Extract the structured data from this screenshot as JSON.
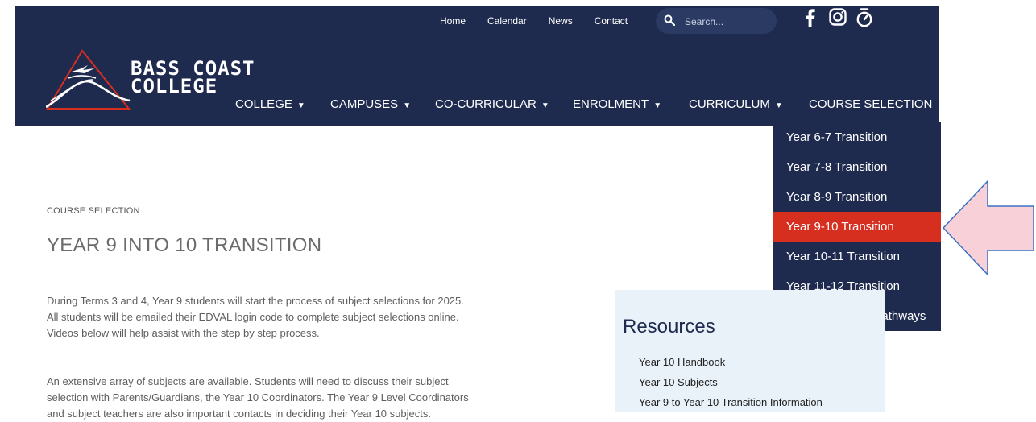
{
  "top_nav": [
    "Home",
    "Calendar",
    "News",
    "Contact"
  ],
  "search": {
    "placeholder": "Search..."
  },
  "brand": {
    "line1": "BASS COAST",
    "line2": "COLLEGE"
  },
  "main_nav": {
    "college": "COLLEGE",
    "campuses": "CAMPUSES",
    "co_curricular": "CO-CURRICULAR",
    "enrolment": "ENROLMENT",
    "curriculum": "CURRICULUM",
    "course_selection": "COURSE SELECTION"
  },
  "dropdown": [
    "Year 6-7 Transition",
    "Year 7-8 Transition",
    "Year 8-9 Transition",
    "Year 9-10 Transition",
    "Year 10-11 Transition",
    "Year 11-12 Transition",
    "Year 12 Tertiary Pathways"
  ],
  "dropdown_active": "Year 9-10 Transition",
  "breadcrumb": "COURSE SELECTION",
  "page_title": "YEAR 9 INTO 10 TRANSITION",
  "paragraphs": [
    [
      "During Terms 3 and 4, Year 9 students will start the process of subject selections for 2025.",
      "All students will be emailed their EDVAL login code to complete subject selections online.",
      "Videos below will help assist with the step by step process."
    ],
    [
      "An extensive array of subjects are available. Students will need to discuss their subject",
      "selection with Parents/Guardians, the Year 10 Coordinators. The Year 9 Level Coordinators",
      "and subject teachers are also important contacts in deciding their Year 10 subjects."
    ]
  ],
  "resources": {
    "title": "Resources",
    "links": [
      "Year 10 Handbook",
      "Year 10 Subjects",
      "Year 9 to Year 10 Transition Information"
    ]
  },
  "icons": [
    "search-icon",
    "facebook-icon",
    "instagram-icon",
    "stopwatch-icon",
    "caret-down-icon"
  ],
  "colors": {
    "header": "#1e2a4e",
    "active": "#d62e1f",
    "resources_bg": "#e9f2f9",
    "arrow_fill": "#f7d0d8",
    "arrow_stroke": "#3a6fc4"
  }
}
